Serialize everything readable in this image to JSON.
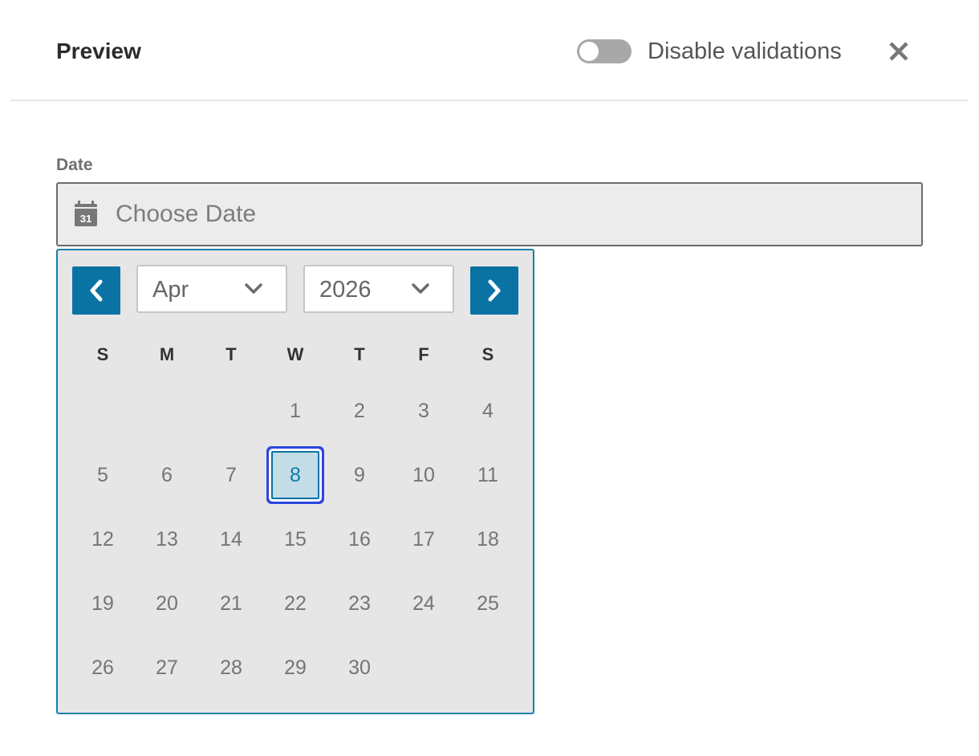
{
  "header": {
    "title": "Preview",
    "toggle_label": "Disable validations",
    "toggle_on": false,
    "close_icon": "close-icon"
  },
  "field": {
    "label": "Date",
    "placeholder": "Choose Date",
    "icon": "calendar-icon",
    "icon_day": "31"
  },
  "calendar": {
    "prev_icon": "chevron-left-icon",
    "next_icon": "chevron-right-icon",
    "month": "Apr",
    "year": "2026",
    "weekdays": [
      "S",
      "M",
      "T",
      "W",
      "T",
      "F",
      "S"
    ],
    "first_weekday_index": 3,
    "days": [
      "1",
      "2",
      "3",
      "4",
      "5",
      "6",
      "7",
      "8",
      "9",
      "10",
      "11",
      "12",
      "13",
      "14",
      "15",
      "16",
      "17",
      "18",
      "19",
      "20",
      "21",
      "22",
      "23",
      "24",
      "25",
      "26",
      "27",
      "28",
      "29",
      "30"
    ],
    "selected_day": "8",
    "accent_color": "#0a73a3",
    "focus_ring_color": "#2c46e0"
  }
}
